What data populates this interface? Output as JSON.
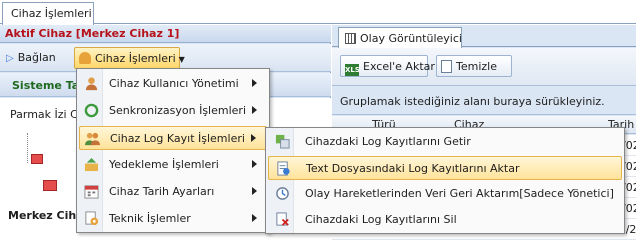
{
  "outer_tab": {
    "label": "Cihaz İşlemleri"
  },
  "left": {
    "header": "Aktif Cihaz [Merkez Cihaz 1]",
    "toolbar": {
      "connect_label": "Bağlan",
      "device_ops_label": "Cihaz İşlemleri"
    },
    "system_bar": "Sisteme Ta",
    "fingerprint_label": "Parmak İzi Ci",
    "device_label": "Merkez Ciha"
  },
  "right": {
    "tab_label": "Olay Görüntüleyici",
    "toolbar": {
      "excel_label": "Excel'e Aktar",
      "clear_label": "Temizle",
      "excel_icon_text": "XLS"
    },
    "group_hint": "Gruplamak istediğiniz alanı buraya sürükleyiniz.",
    "grid_headers": [
      "Türü",
      "Cihaz",
      "Tarih"
    ],
    "rows": [
      {
        "type": "",
        "device": "",
        "date": "08/02"
      },
      {
        "type": "",
        "device": "",
        "date": "08/02"
      },
      {
        "type": "",
        "device": "",
        "date": "08/02"
      },
      {
        "type": "",
        "device": "",
        "date": "08/02"
      },
      {
        "type": "Hata",
        "device": "Merkez Cihaz 2",
        "date": "08/02/20"
      }
    ]
  },
  "menu": {
    "items": [
      {
        "label": "Cihaz Kullanıcı Yönetimi",
        "icon": "user-icon",
        "has_submenu": true
      },
      {
        "label": "Senkronizasyon İşlemleri",
        "icon": "sync-icon",
        "has_submenu": true
      },
      {
        "label": "Cihaz Log Kayıt İşlemleri",
        "icon": "users-log-icon",
        "has_submenu": true,
        "selected": true
      },
      {
        "label": "Yedekleme İşlemleri",
        "icon": "backup-icon",
        "has_submenu": true
      },
      {
        "label": "Cihaz Tarih Ayarları",
        "icon": "calendar-icon",
        "has_submenu": true
      },
      {
        "label": "Teknik İşlemler",
        "icon": "tools-icon",
        "has_submenu": true
      }
    ]
  },
  "submenu": {
    "items": [
      {
        "label": "Cihazdaki Log Kayıtlarını Getir",
        "icon": "download-log-icon"
      },
      {
        "label": "Text Dosyasındaki Log Kayıtlarını Aktar",
        "icon": "text-file-icon",
        "selected": true
      },
      {
        "label": "Olay Hareketlerinden Veri Geri Aktarım[Sadece Yönetici]",
        "icon": "restore-icon"
      },
      {
        "label": "Cihazdaki Log Kayıtlarını Sil",
        "icon": "delete-log-icon"
      }
    ]
  },
  "colors": {
    "accent_red": "#b5121b",
    "accent_green": "#1f6a1f",
    "highlight": "#ffe39a",
    "panel_bg": "#dbe6f4"
  }
}
